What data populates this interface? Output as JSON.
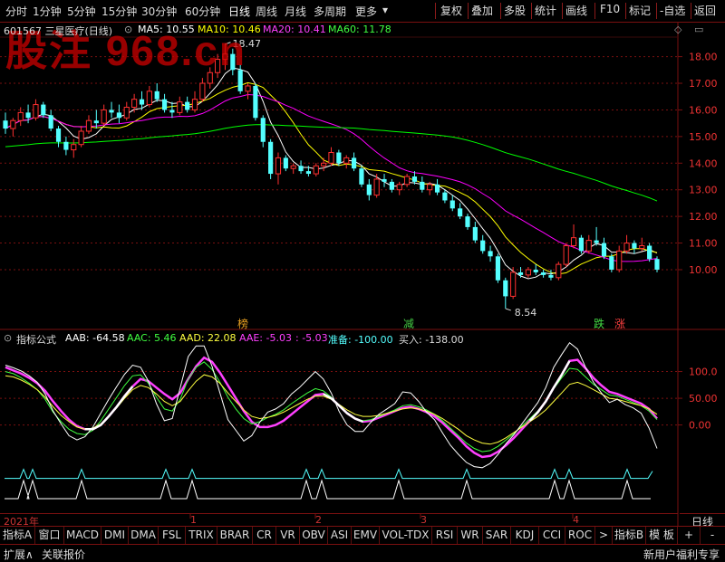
{
  "toolbar": {
    "periods": [
      "分时",
      "1分钟",
      "5分钟",
      "15分钟",
      "30分钟",
      "60分钟",
      "日线",
      "周线",
      "月线",
      "多周期",
      "更多"
    ],
    "more_arrow": "▾",
    "right_buttons": [
      "复权",
      "叠加",
      "多股",
      "统计",
      "画线",
      "F10",
      "标记",
      "-自选",
      "返回"
    ]
  },
  "watermark": "股注 968.cn",
  "price_info": {
    "code_name": "601567 三星医疗(日线)",
    "ma5": "MA5: 10.55",
    "ma10": "MA10: 10.46",
    "ma20": "MA20: 10.41",
    "ma60": "MA60: 11.78"
  },
  "price_axis": [
    "18.00",
    "17.00",
    "16.00",
    "15.00",
    "14.00",
    "13.00",
    "12.00",
    "11.00",
    "10.00"
  ],
  "annotations": {
    "high": "18.47",
    "low": "8.54"
  },
  "signals": [
    {
      "text": "榜",
      "color": "#e8a020"
    },
    {
      "text": "减",
      "color": "#44cc44"
    },
    {
      "text": "跌",
      "color": "#44dd44"
    },
    {
      "text": "涨",
      "color": "#ff4040"
    }
  ],
  "indicator_info": {
    "name": "指标公式",
    "aab": "AAB: -64.58",
    "aac": "AAC: 5.46",
    "aad": "AAD: 22.08",
    "aae": "AAE: -5.03",
    "aae2": ": -5.03",
    "zhunbei": "准备: -100.00",
    "mairu": "买入: -138.00"
  },
  "indicator_axis": [
    "100.0",
    "50.00",
    "0.00"
  ],
  "time_axis": [
    "2021年",
    "1",
    "2",
    "3",
    "4"
  ],
  "tabs": [
    "指标A",
    "窗口",
    "MACD",
    "DMI",
    "DMA",
    "FSL",
    "TRIX",
    "BRAR",
    "CR",
    "VR",
    "OBV",
    "ASI",
    "EMV",
    "VOL-TDX",
    "RSI",
    "WR",
    "SAR",
    "KDJ",
    "CCI",
    "ROC",
    ">",
    "指标B",
    "模 板",
    "+",
    "-"
  ],
  "period_label": "日线",
  "status": {
    "left1": "扩展∧",
    "left2": "关联报价",
    "right": "新用户福利专享"
  },
  "colors": {
    "up": "#ff3030",
    "down": "#54ffff",
    "ma5": "#ffffff",
    "ma10": "#ffff00",
    "ma20": "#ff00ff",
    "ma60": "#00ff00",
    "grid": "#7a1010"
  },
  "chart_data": [
    {
      "type": "candlestick",
      "series": [
        {
          "name": "MA5",
          "values": []
        },
        {
          "name": "MA10",
          "values": []
        },
        {
          "name": "MA20",
          "values": []
        },
        {
          "name": "MA60",
          "values": []
        }
      ],
      "ylim": [
        8.3,
        18.7
      ],
      "ticks": [
        10,
        11,
        12,
        13,
        14,
        15,
        16,
        17,
        18
      ],
      "ohlc": [
        [
          15.6,
          15.9,
          15.1,
          15.3
        ],
        [
          15.3,
          15.7,
          15.0,
          15.6
        ],
        [
          15.6,
          16.1,
          15.4,
          15.9
        ],
        [
          15.9,
          16.2,
          15.5,
          15.7
        ],
        [
          15.7,
          16.4,
          15.6,
          16.2
        ],
        [
          16.2,
          16.3,
          15.7,
          15.8
        ],
        [
          15.8,
          16.0,
          15.2,
          15.3
        ],
        [
          15.3,
          15.4,
          14.6,
          14.8
        ],
        [
          14.8,
          15.0,
          14.3,
          14.5
        ],
        [
          14.5,
          14.9,
          14.2,
          14.7
        ],
        [
          14.7,
          15.4,
          14.6,
          15.2
        ],
        [
          15.2,
          15.8,
          15.1,
          15.6
        ],
        [
          15.6,
          16.0,
          15.3,
          15.5
        ],
        [
          15.5,
          16.2,
          15.4,
          16.0
        ],
        [
          16.0,
          16.3,
          15.7,
          15.9
        ],
        [
          15.9,
          16.2,
          15.5,
          15.7
        ],
        [
          15.7,
          16.3,
          15.6,
          16.1
        ],
        [
          16.1,
          16.6,
          15.9,
          16.4
        ],
        [
          16.4,
          16.7,
          16.0,
          16.2
        ],
        [
          16.2,
          16.9,
          16.1,
          16.7
        ],
        [
          16.7,
          17.0,
          16.3,
          16.4
        ],
        [
          16.4,
          16.6,
          15.9,
          16.0
        ],
        [
          16.0,
          16.3,
          15.7,
          15.9
        ],
        [
          15.9,
          16.5,
          15.8,
          16.3
        ],
        [
          16.3,
          16.5,
          15.9,
          16.0
        ],
        [
          16.0,
          16.7,
          15.9,
          16.4
        ],
        [
          16.4,
          17.2,
          16.3,
          17.0
        ],
        [
          17.0,
          17.6,
          16.8,
          17.4
        ],
        [
          17.4,
          18.1,
          17.2,
          17.9
        ],
        [
          17.9,
          18.47,
          17.5,
          18.1
        ],
        [
          18.1,
          18.3,
          17.3,
          17.5
        ],
        [
          17.5,
          17.7,
          16.6,
          16.7
        ],
        [
          16.7,
          17.0,
          16.4,
          16.9
        ],
        [
          16.9,
          17.0,
          15.6,
          15.7
        ],
        [
          15.7,
          15.8,
          14.6,
          14.8
        ],
        [
          14.8,
          14.9,
          13.4,
          13.6
        ],
        [
          13.6,
          14.4,
          13.2,
          14.2
        ],
        [
          14.2,
          14.3,
          13.7,
          13.8
        ],
        [
          13.8,
          14.0,
          13.6,
          13.9
        ],
        [
          13.9,
          14.1,
          13.6,
          13.7
        ],
        [
          13.7,
          13.9,
          13.5,
          13.6
        ],
        [
          13.6,
          14.0,
          13.5,
          13.9
        ],
        [
          13.9,
          14.2,
          13.7,
          14.0
        ],
        [
          14.0,
          14.6,
          13.9,
          14.4
        ],
        [
          14.4,
          14.5,
          13.9,
          14.0
        ],
        [
          14.0,
          14.3,
          13.8,
          14.2
        ],
        [
          14.2,
          14.4,
          13.7,
          13.8
        ],
        [
          13.8,
          13.9,
          13.1,
          13.2
        ],
        [
          13.2,
          13.4,
          12.6,
          12.8
        ],
        [
          12.8,
          13.6,
          12.7,
          13.4
        ],
        [
          13.4,
          13.6,
          13.1,
          13.3
        ],
        [
          13.3,
          13.4,
          12.9,
          13.0
        ],
        [
          13.0,
          13.3,
          12.8,
          13.2
        ],
        [
          13.2,
          13.6,
          13.1,
          13.5
        ],
        [
          13.5,
          13.7,
          13.2,
          13.3
        ],
        [
          13.3,
          13.5,
          12.9,
          13.0
        ],
        [
          13.0,
          13.3,
          12.8,
          13.2
        ],
        [
          13.2,
          13.4,
          12.8,
          12.9
        ],
        [
          12.9,
          13.0,
          12.5,
          12.6
        ],
        [
          12.6,
          12.8,
          12.2,
          12.3
        ],
        [
          12.3,
          12.5,
          11.9,
          12.0
        ],
        [
          12.0,
          12.1,
          11.5,
          11.6
        ],
        [
          11.6,
          11.8,
          11.0,
          11.1
        ],
        [
          11.1,
          11.3,
          10.6,
          10.7
        ],
        [
          10.7,
          10.9,
          10.3,
          10.5
        ],
        [
          10.5,
          10.6,
          9.5,
          9.6
        ],
        [
          9.6,
          9.7,
          8.54,
          9.0
        ],
        [
          9.0,
          10.1,
          8.9,
          9.9
        ],
        [
          9.9,
          10.1,
          9.7,
          9.8
        ],
        [
          9.8,
          10.1,
          9.7,
          10.0
        ],
        [
          10.0,
          10.2,
          9.8,
          9.9
        ],
        [
          9.9,
          10.0,
          9.7,
          9.8
        ],
        [
          9.8,
          10.0,
          9.6,
          9.7
        ],
        [
          9.7,
          10.3,
          9.6,
          10.2
        ],
        [
          10.2,
          11.0,
          10.1,
          10.9
        ],
        [
          10.9,
          11.7,
          10.8,
          11.2
        ],
        [
          11.2,
          11.3,
          10.6,
          10.7
        ],
        [
          10.7,
          11.3,
          10.6,
          11.1
        ],
        [
          11.1,
          11.6,
          10.9,
          11.0
        ],
        [
          11.0,
          11.2,
          10.4,
          10.5
        ],
        [
          10.5,
          10.6,
          9.9,
          10.0
        ],
        [
          10.0,
          10.9,
          9.9,
          10.7
        ],
        [
          10.7,
          11.3,
          10.6,
          11.0
        ],
        [
          11.0,
          11.1,
          10.6,
          10.8
        ],
        [
          10.8,
          11.2,
          10.7,
          10.9
        ],
        [
          10.9,
          11.0,
          10.3,
          10.4
        ],
        [
          10.4,
          10.5,
          9.9,
          10.0
        ]
      ]
    },
    {
      "type": "line",
      "series": [
        {
          "name": "AAB",
          "values": [
            112,
            107,
            101,
            92,
            80,
            58,
            26,
            2,
            -20,
            -28,
            -22,
            -4,
            22,
            48,
            72,
            95,
            112,
            108,
            82,
            40,
            8,
            12,
            70,
            128,
            148,
            148,
            110,
            60,
            10,
            -10,
            -30,
            -20,
            5,
            24,
            30,
            40,
            58,
            70,
            85,
            100,
            86,
            60,
            25,
            0,
            -12,
            -12,
            5,
            20,
            30,
            40,
            62,
            60,
            44,
            24,
            10,
            -15,
            -38,
            -55,
            -70,
            -78,
            -80,
            -72,
            -55,
            -35,
            -18,
            2,
            22,
            42,
            70,
            108,
            132,
            154,
            142,
            108,
            80,
            60,
            42,
            48,
            38,
            32,
            22,
            -6,
            -44
          ]
        },
        {
          "name": "AAC",
          "values": [
            100,
            96,
            88,
            78,
            66,
            48,
            24,
            6,
            -8,
            -16,
            -18,
            -10,
            8,
            30,
            52,
            74,
            92,
            94,
            78,
            52,
            30,
            26,
            48,
            86,
            108,
            118,
            104,
            80,
            52,
            30,
            12,
            2,
            6,
            14,
            20,
            28,
            40,
            50,
            60,
            68,
            64,
            52,
            36,
            22,
            12,
            8,
            10,
            16,
            22,
            28,
            36,
            38,
            34,
            28,
            20,
            8,
            -6,
            -20,
            -34,
            -44,
            -50,
            -48,
            -40,
            -28,
            -16,
            -2,
            12,
            26,
            44,
            68,
            88,
            106,
            104,
            90,
            76,
            66,
            56,
            54,
            48,
            42,
            36,
            26,
            10
          ]
        },
        {
          "name": "AAD",
          "values": [
            92,
            90,
            84,
            76,
            66,
            52,
            34,
            18,
            6,
            -4,
            -8,
            -6,
            2,
            16,
            32,
            50,
            66,
            74,
            70,
            58,
            44,
            36,
            44,
            64,
            82,
            94,
            90,
            78,
            60,
            44,
            28,
            16,
            12,
            14,
            18,
            24,
            32,
            40,
            48,
            54,
            54,
            48,
            38,
            28,
            20,
            16,
            16,
            18,
            22,
            26,
            30,
            32,
            30,
            26,
            20,
            12,
            2,
            -8,
            -20,
            -28,
            -34,
            -36,
            -32,
            -24,
            -14,
            -4,
            6,
            16,
            28,
            44,
            60,
            76,
            80,
            74,
            66,
            58,
            50,
            48,
            44,
            40,
            36,
            30,
            20
          ]
        },
        {
          "name": "AAE",
          "values": [
            108,
            102,
            96,
            88,
            78,
            64,
            44,
            26,
            10,
            -2,
            -8,
            -8,
            0,
            16,
            34,
            54,
            72,
            86,
            82,
            70,
            58,
            48,
            60,
            86,
            110,
            126,
            118,
            98,
            74,
            50,
            26,
            6,
            -4,
            -4,
            0,
            8,
            20,
            32,
            44,
            56,
            58,
            50,
            36,
            22,
            12,
            6,
            8,
            14,
            20,
            26,
            32,
            34,
            30,
            24,
            16,
            4,
            -10,
            -24,
            -40,
            -52,
            -60,
            -58,
            -50,
            -38,
            -24,
            -8,
            8,
            24,
            44,
            70,
            94,
            120,
            122,
            106,
            88,
            74,
            62,
            58,
            52,
            46,
            40,
            30,
            12
          ]
        },
        {
          "name": "准备",
          "values": []
        },
        {
          "name": "买入",
          "values": []
        }
      ],
      "ylim": [
        -160,
        145
      ],
      "ticks": [
        100,
        50,
        0
      ]
    }
  ]
}
